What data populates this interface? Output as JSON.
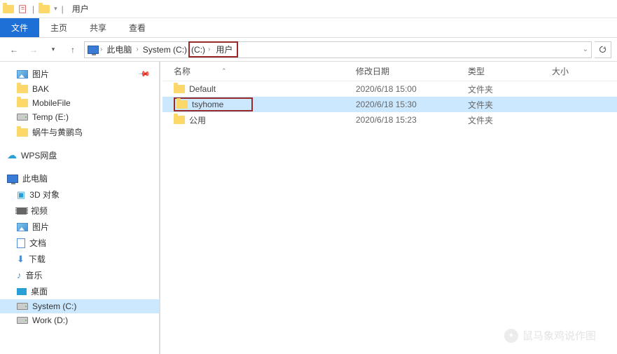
{
  "titlebar": {
    "title": "用户"
  },
  "ribbon": {
    "file": "文件",
    "home": "主页",
    "share": "共享",
    "view": "查看"
  },
  "breadcrumb": {
    "root_icon": "pc",
    "items": [
      "此电脑",
      "System (C:)",
      "用户"
    ]
  },
  "sidebar": {
    "quick": [
      {
        "label": "图片",
        "icon": "img"
      },
      {
        "label": "BAK",
        "icon": "folder"
      },
      {
        "label": "MobileFile",
        "icon": "folder"
      },
      {
        "label": "Temp (E:)",
        "icon": "drive"
      },
      {
        "label": "蜗牛与黄鹂鸟",
        "icon": "folder"
      }
    ],
    "cloud": {
      "label": "WPS网盘",
      "icon": "cloud"
    },
    "pc": {
      "label": "此电脑",
      "icon": "pc"
    },
    "pc_children": [
      {
        "label": "3D 对象",
        "icon": "3d"
      },
      {
        "label": "视频",
        "icon": "video"
      },
      {
        "label": "图片",
        "icon": "img"
      },
      {
        "label": "文档",
        "icon": "doc"
      },
      {
        "label": "下载",
        "icon": "dl"
      },
      {
        "label": "音乐",
        "icon": "music"
      },
      {
        "label": "桌面",
        "icon": "desk"
      },
      {
        "label": "System (C:)",
        "icon": "drive",
        "selected": true
      },
      {
        "label": "Work (D:)",
        "icon": "drive"
      }
    ]
  },
  "columns": {
    "name": "名称",
    "date": "修改日期",
    "type": "类型",
    "size": "大小"
  },
  "files": [
    {
      "name": "Default",
      "date": "2020/6/18 15:00",
      "type": "文件夹",
      "highlighted": false
    },
    {
      "name": "tsyhome",
      "date": "2020/6/18 15:30",
      "type": "文件夹",
      "highlighted": true,
      "selected": true
    },
    {
      "name": "公用",
      "date": "2020/6/18 15:23",
      "type": "文件夹",
      "highlighted": false
    }
  ],
  "watermark": "鼠马象鸡说作图"
}
